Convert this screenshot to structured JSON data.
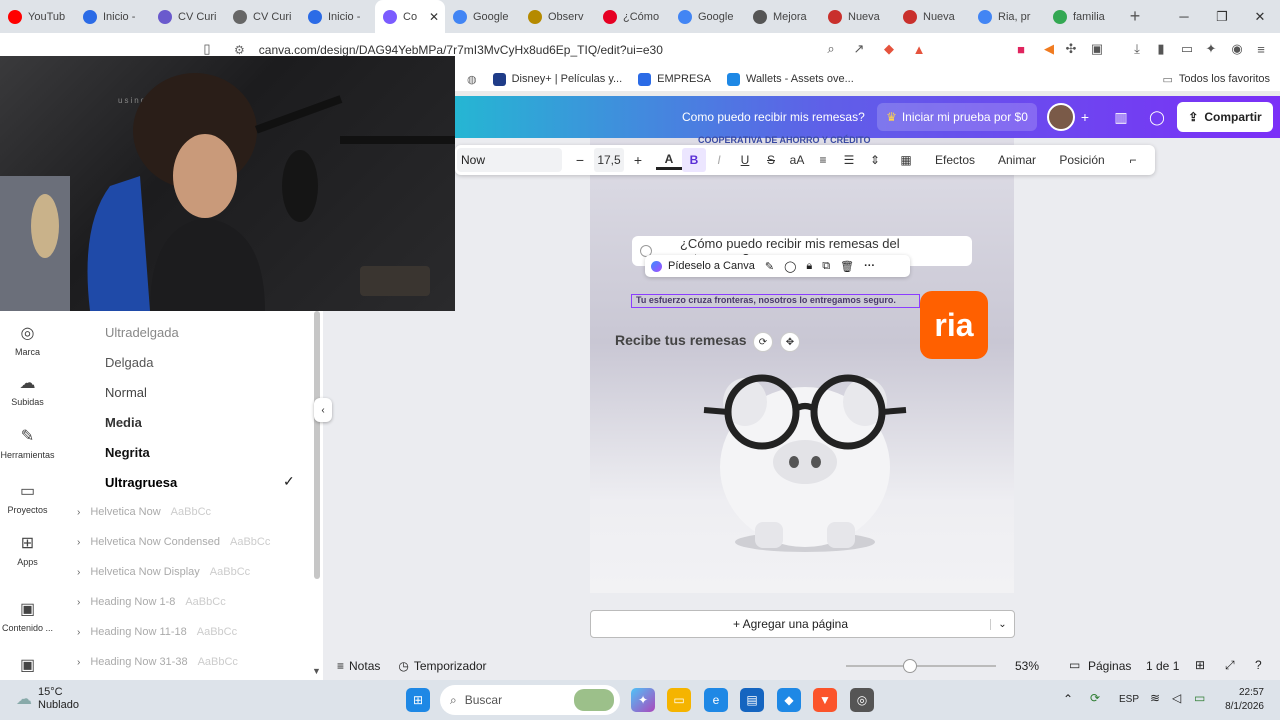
{
  "browser": {
    "tabs": [
      {
        "label": "YouTub",
        "color": "#ff0000"
      },
      {
        "label": "Inicio -",
        "color": "#2b6be6"
      },
      {
        "label": "CV Curi",
        "color": "#6a5acd"
      },
      {
        "label": "CV Curi",
        "color": "#666666"
      },
      {
        "label": "Inicio -",
        "color": "#2b6be6"
      },
      {
        "label": "Co",
        "color": "#7b5cff",
        "active": true
      },
      {
        "label": "Google",
        "color": "#4285f4"
      },
      {
        "label": "Observ",
        "color": "#b58a00"
      },
      {
        "label": "¿Cómo",
        "color": "#e60023"
      },
      {
        "label": "Google",
        "color": "#4285f4"
      },
      {
        "label": "Mejora",
        "color": "#555555"
      },
      {
        "label": "Nueva",
        "color": "#c9302c"
      },
      {
        "label": "Nueva",
        "color": "#c9302c"
      },
      {
        "label": "Ria, pr",
        "color": "#4285f4"
      },
      {
        "label": "familia",
        "color": "#34a853"
      }
    ],
    "url": "canva.com/design/DAG94YebMPa/7r7mI3MvCyHx8ud6Ep_TIQ/edit?ui=e30",
    "bookmarks": [
      {
        "label": "Disney+ | Películas y...",
        "color": "#1f3c88"
      },
      {
        "label": "EMPRESA",
        "color": "#2b6be6"
      },
      {
        "label": "Wallets - Assets ove...",
        "color": "#1e88e5"
      }
    ],
    "all_bookmarks": "Todos los favoritos"
  },
  "webcam": {
    "watermark": "using droidcam.app"
  },
  "canva_header": {
    "title": "Como puedo recibir mis remesas?",
    "trial_button": "Iniciar mi prueba por $0",
    "share_button": "Compartir"
  },
  "text_toolbar": {
    "font": "Now",
    "size": "17,5",
    "effects": "Efectos",
    "animate": "Animar",
    "position": "Posición"
  },
  "sidebar": {
    "items": [
      {
        "label": "Marca",
        "icon": "brand-icon"
      },
      {
        "label": "Subidas",
        "icon": "upload-icon"
      },
      {
        "label": "Herramientas",
        "icon": "draw-icon"
      },
      {
        "label": "Proyectos",
        "icon": "folder-icon"
      },
      {
        "label": "Apps",
        "icon": "apps-icon"
      },
      {
        "label": "Contenido ...",
        "icon": "content-icon"
      }
    ]
  },
  "font_panel": {
    "weights": [
      {
        "label": "Ultradelgada",
        "color": "#888888"
      },
      {
        "label": "Delgada",
        "color": "#555555"
      },
      {
        "label": "Normal",
        "color": "#444444"
      },
      {
        "label": "Media",
        "color": "#333333"
      },
      {
        "label": "Negrita",
        "color": "#111111"
      },
      {
        "label": "Ultragruesa",
        "color": "#000000",
        "selected": true
      }
    ],
    "families": [
      {
        "name": "Helvetica Now",
        "sample": "AaBbCc"
      },
      {
        "name": "Helvetica Now Condensed",
        "sample": "AaBbCc"
      },
      {
        "name": "Helvetica Now Display",
        "sample": "AaBbCc"
      },
      {
        "name": "Heading Now 1-8",
        "sample": "AaBbCc"
      },
      {
        "name": "Heading Now 11-18",
        "sample": "AaBbCc"
      },
      {
        "name": "Heading Now 31-38",
        "sample": "AaBbCc"
      }
    ]
  },
  "design": {
    "coop_text": "COOPERATIVA DE AHORRO Y CRÉDITO",
    "question": "¿Cómo puedo recibir mis remesas del extrangero?",
    "ask_canva": "Pídeselo a Canva",
    "tagline": "Tu esfuerzo cruza fronteras, nosotros lo entregamos seguro.",
    "brand_logo": "ria",
    "subtitle": "Recibe tus remesas",
    "brand_color": "#ff6000"
  },
  "add_page": "+ Agregar una página",
  "footer": {
    "notes": "Notas",
    "timer": "Temporizador",
    "zoom": "53%",
    "pages": "Páginas",
    "page_count": "1 de 1"
  },
  "taskbar": {
    "temp": "15°C",
    "weather": "Nublado",
    "search": "Buscar",
    "lang": "ESP",
    "time": "22:57",
    "date": "8/1/2026"
  }
}
